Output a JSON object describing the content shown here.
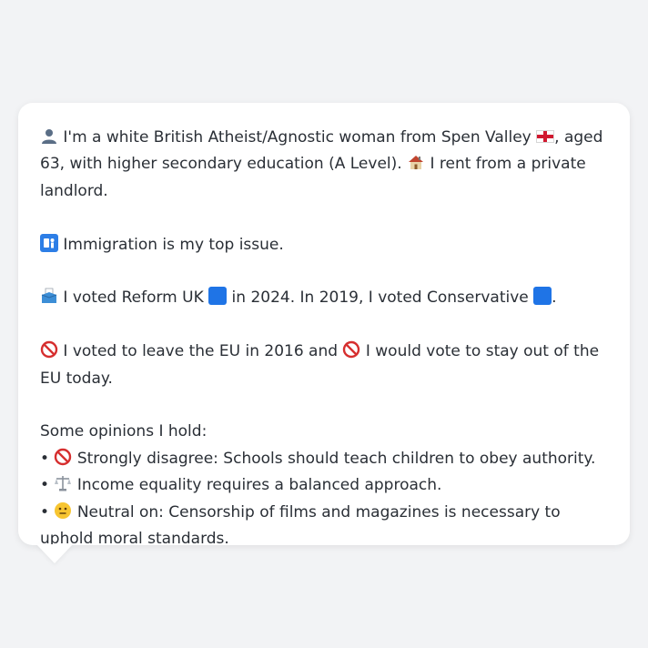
{
  "bubble": {
    "line1": {
      "text_a": " I'm a white British Atheist/Agnostic woman from Spen Valley ",
      "text_b": ", aged 63, with higher secondary education (A Level). ",
      "text_c": " I rent from a private landlord."
    },
    "issue": {
      "text": " Immigration is my top issue."
    },
    "vote": {
      "text_a": " I voted Reform UK ",
      "text_b": " in 2024. In 2019, I voted Conservative ",
      "text_c": "."
    },
    "eu": {
      "text_a": " I voted to leave the EU in 2016 and ",
      "text_b": " I would vote to stay out of the EU today."
    },
    "opinions": {
      "heading": "Some opinions I hold:",
      "items": [
        {
          "bullet": "•",
          "text": " Strongly disagree: Schools should teach children to obey authority."
        },
        {
          "bullet": "•",
          "text": " Income equality requires a balanced approach."
        },
        {
          "bullet": "•",
          "text": " Neutral on: Censorship of films and magazines is necessary to uphold moral standards."
        }
      ]
    }
  },
  "colors": {
    "background": "#f2f3f5",
    "bubble": "#ffffff",
    "text": "#2a2f36",
    "reform_blue": "#1f74e6",
    "conservative_blue": "#1f74e6",
    "no_entry_red": "#d62f2f"
  },
  "icons": [
    "person-icon",
    "england-flag-icon",
    "house-icon",
    "passport-control-icon",
    "ballot-box-icon",
    "reform-square-icon",
    "conservative-square-icon",
    "no-entry-icon",
    "balance-scale-icon",
    "neutral-face-icon"
  ]
}
